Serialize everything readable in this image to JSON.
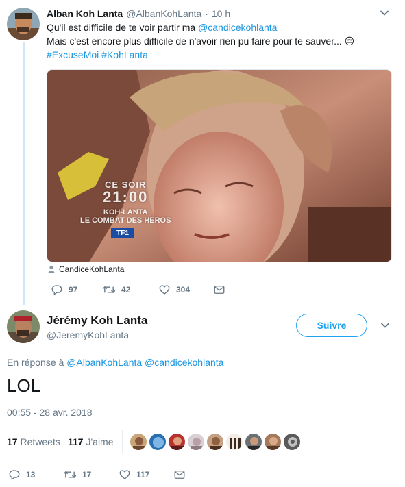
{
  "parent_tweet": {
    "display_name": "Alban Koh Lanta",
    "handle": "@AlbanKohLanta",
    "separator": "·",
    "time": "10 h",
    "line1_prefix": "Qu'il est difficile de te voir partir ma ",
    "line1_mention": "@candicekohlanta",
    "line2": "Mais c'est encore plus difficile de n'avoir rien pu faire pour te sauver...",
    "line2_emoji": "😔",
    "hashtag1": "#ExcuseMoi",
    "hashtag2": "#KohLanta",
    "media_overlay": {
      "line1": "CE SOIR",
      "line2": "21:00",
      "line3": "KOH-LANTA",
      "line4": "LE COMBAT DES HEROS",
      "channel": "TF1"
    },
    "media_tag": "CandiceKohLanta",
    "replies": "97",
    "retweets": "42",
    "likes": "304"
  },
  "main_tweet": {
    "display_name": "Jérémy Koh Lanta",
    "handle": "@JeremyKohLanta",
    "follow_label": "Suivre",
    "reply_prefix": "En réponse à",
    "reply_to_1": "@AlbanKohLanta",
    "reply_to_2": "@candicekohlanta",
    "text": "LOL",
    "timestamp": "00:55 - 28 avr. 2018",
    "retweet_count": "17",
    "retweet_label": "Retweets",
    "like_count": "117",
    "like_label": "J'aime",
    "replies": "13",
    "retweets": "17",
    "likes": "117"
  },
  "icons": {
    "reply": "reply-icon",
    "retweet": "retweet-icon",
    "like": "heart-icon",
    "dm": "envelope-icon",
    "caret": "chevron-down-icon",
    "person": "person-icon"
  },
  "colors": {
    "link": "#1b95e0",
    "muted": "#657786",
    "accent": "#1da1f2",
    "thread": "#cfe6f7"
  }
}
